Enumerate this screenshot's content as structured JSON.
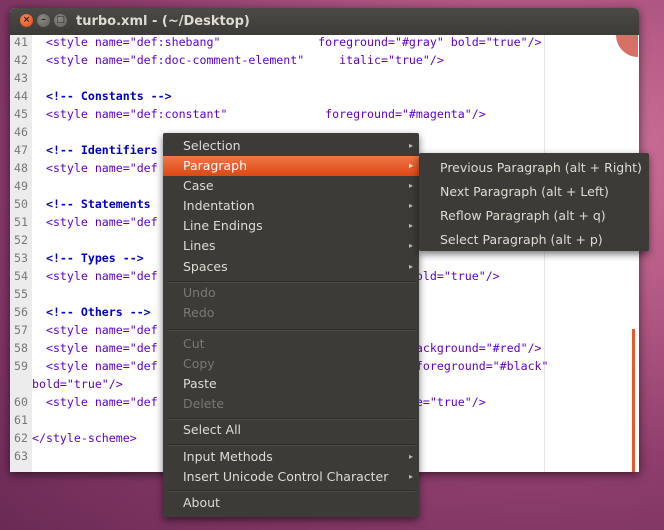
{
  "window": {
    "title": "turbo.xml - (~/Desktop)",
    "close_glyph": "×",
    "min_glyph": "–",
    "max_glyph": "□"
  },
  "editor": {
    "lines": [
      {
        "num": "41",
        "text": "  <style name=\"def:shebang\"              foreground=\"#gray\" bold=\"true\"/>",
        "kind": "code"
      },
      {
        "num": "42",
        "text": "  <style name=\"def:doc-comment-element\"     italic=\"true\"/>",
        "kind": "code"
      },
      {
        "num": "43",
        "text": "",
        "kind": "code"
      },
      {
        "num": "44",
        "text": "  <!-- Constants -->",
        "kind": "comment"
      },
      {
        "num": "45",
        "text": "  <style name=\"def:constant\"              foreground=\"#magenta\"/>",
        "kind": "code"
      },
      {
        "num": "46",
        "text": "",
        "kind": "code"
      },
      {
        "num": "47",
        "text": "  <!-- Identifiers",
        "kind": "comment"
      },
      {
        "num": "48",
        "text": "  <style name=\"def",
        "kind": "code"
      },
      {
        "num": "49",
        "text": "",
        "kind": "code"
      },
      {
        "num": "50",
        "text": "  <!-- Statements",
        "kind": "comment"
      },
      {
        "num": "51",
        "text": "  <style name=\"def",
        "kind": "code"
      },
      {
        "num": "52",
        "text": "",
        "kind": "code"
      },
      {
        "num": "53",
        "text": "  <!-- Types -->",
        "kind": "comment"
      },
      {
        "num": "54",
        "text": "  <style name=\"def                           \"#white\" bold=\"true\"/>",
        "kind": "code"
      },
      {
        "num": "55",
        "text": "",
        "kind": "code"
      },
      {
        "num": "56",
        "text": "  <!-- Others -->",
        "kind": "comment"
      },
      {
        "num": "57",
        "text": "  <style name=\"def                           \"#green\"/>",
        "kind": "code"
      },
      {
        "num": "58",
        "text": "  <style name=\"def                           \"#white\" background=\"#red\"/>",
        "kind": "code"
      },
      {
        "num": "59",
        "text": "  <style name=\"def                           \"#yellow\" foreground=\"#black\"",
        "kind": "code"
      },
      {
        "num": "",
        "text": "bold=\"true\"/>",
        "kind": "code"
      },
      {
        "num": "60",
        "text": "  <style name=\"def                          e\" underline=\"true\"/>",
        "kind": "code"
      },
      {
        "num": "61",
        "text": "",
        "kind": "code"
      },
      {
        "num": "62",
        "text": "</style-scheme>",
        "kind": "code"
      },
      {
        "num": "63",
        "text": "",
        "kind": "code"
      }
    ]
  },
  "context_menu": {
    "items": [
      {
        "label": "Selection",
        "submenu": true,
        "disabled": false,
        "active": false
      },
      {
        "label": "Paragraph",
        "submenu": true,
        "disabled": false,
        "active": true
      },
      {
        "label": "Case",
        "submenu": true,
        "disabled": false,
        "active": false
      },
      {
        "label": "Indentation",
        "submenu": true,
        "disabled": false,
        "active": false
      },
      {
        "label": "Line Endings",
        "submenu": true,
        "disabled": false,
        "active": false
      },
      {
        "label": "Lines",
        "submenu": true,
        "disabled": false,
        "active": false
      },
      {
        "label": "Spaces",
        "submenu": true,
        "disabled": false,
        "active": false
      },
      {
        "label": "Undo",
        "submenu": false,
        "disabled": true,
        "active": false
      },
      {
        "label": "Redo",
        "submenu": false,
        "disabled": true,
        "active": false
      },
      {
        "label": "Cut",
        "submenu": false,
        "disabled": true,
        "active": false
      },
      {
        "label": "Copy",
        "submenu": false,
        "disabled": true,
        "active": false
      },
      {
        "label": "Paste",
        "submenu": false,
        "disabled": false,
        "active": false
      },
      {
        "label": "Delete",
        "submenu": false,
        "disabled": true,
        "active": false
      },
      {
        "label": "Select All",
        "submenu": false,
        "disabled": false,
        "active": false
      },
      {
        "label": "Input Methods",
        "submenu": true,
        "disabled": false,
        "active": false
      },
      {
        "label": "Insert Unicode Control Character",
        "submenu": true,
        "disabled": false,
        "active": false
      },
      {
        "label": "About",
        "submenu": false,
        "disabled": false,
        "active": false
      }
    ],
    "arrow_glyph": "▸"
  },
  "paragraph_submenu": {
    "items": [
      {
        "label": "Previous Paragraph (alt + Right)"
      },
      {
        "label": "Next Paragraph (alt + Left)"
      },
      {
        "label": "Reflow Paragraph (alt + q)"
      },
      {
        "label": "Select Paragraph (alt + p)"
      }
    ]
  },
  "colors": {
    "accent": "#dd4814",
    "menu_bg": "#3c3b37",
    "code": "#5c00c8",
    "comment": "#0000c0"
  }
}
